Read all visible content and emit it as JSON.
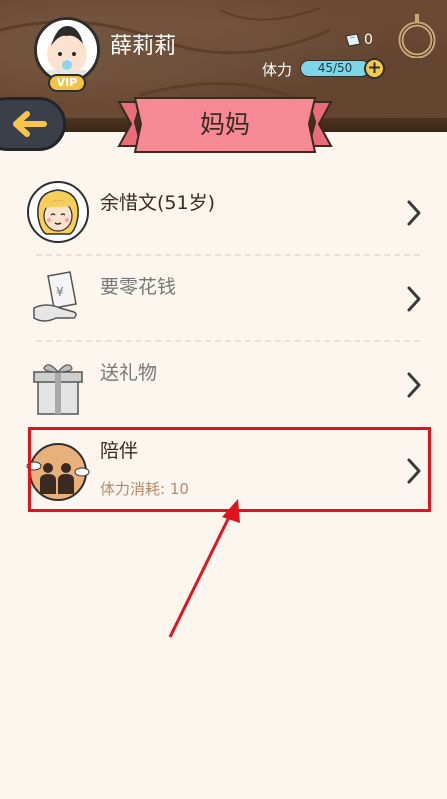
{
  "header": {
    "username": "薛莉莉",
    "vip_label": "VIP",
    "coins": "0",
    "stamina_label": "体力",
    "stamina_value": "45/50",
    "plus_label": "+"
  },
  "page": {
    "title": "妈妈"
  },
  "list": {
    "profile": {
      "label": "余惜文(51岁)"
    },
    "pocket_money": {
      "label": "要零花钱"
    },
    "gift": {
      "label": "送礼物"
    },
    "companion": {
      "label": "陪伴",
      "sub": "体力消耗: 10"
    }
  },
  "colors": {
    "header_bg": "#6b4a33",
    "ribbon": "#f58a94",
    "background": "#fdf6ee",
    "highlight": "#e0141e",
    "accent_text": "#b48a6a"
  },
  "icons": [
    "baby-avatar-icon",
    "coin-ticket-icon",
    "plus-icon",
    "ring-icon",
    "back-arrow-icon",
    "mother-avatar-icon",
    "money-hand-icon",
    "gift-box-icon",
    "family-silhouette-icon",
    "chevron-right-icon"
  ]
}
